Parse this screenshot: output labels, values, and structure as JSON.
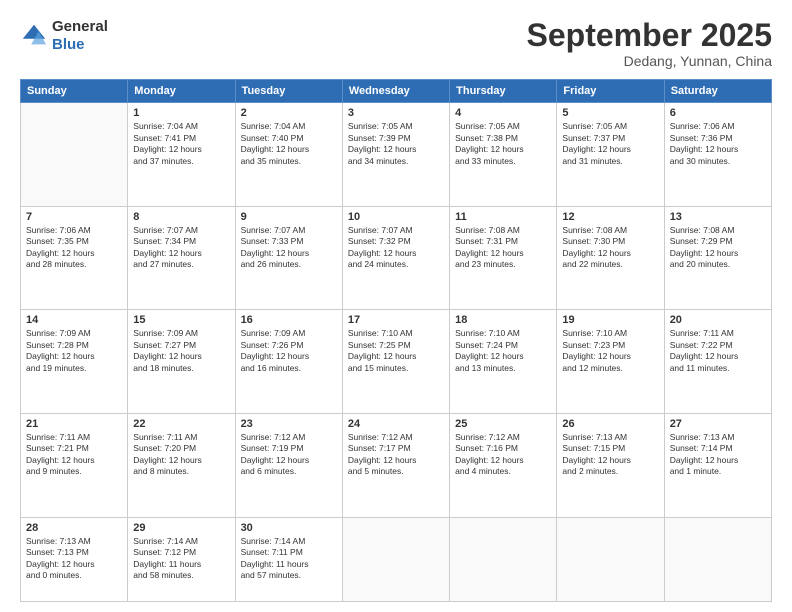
{
  "header": {
    "logo": {
      "general": "General",
      "blue": "Blue"
    },
    "month": "September 2025",
    "location": "Dedang, Yunnan, China"
  },
  "weekdays": [
    "Sunday",
    "Monday",
    "Tuesday",
    "Wednesday",
    "Thursday",
    "Friday",
    "Saturday"
  ],
  "weeks": [
    [
      {
        "num": "",
        "info": ""
      },
      {
        "num": "1",
        "info": "Sunrise: 7:04 AM\nSunset: 7:41 PM\nDaylight: 12 hours\nand 37 minutes."
      },
      {
        "num": "2",
        "info": "Sunrise: 7:04 AM\nSunset: 7:40 PM\nDaylight: 12 hours\nand 35 minutes."
      },
      {
        "num": "3",
        "info": "Sunrise: 7:05 AM\nSunset: 7:39 PM\nDaylight: 12 hours\nand 34 minutes."
      },
      {
        "num": "4",
        "info": "Sunrise: 7:05 AM\nSunset: 7:38 PM\nDaylight: 12 hours\nand 33 minutes."
      },
      {
        "num": "5",
        "info": "Sunrise: 7:05 AM\nSunset: 7:37 PM\nDaylight: 12 hours\nand 31 minutes."
      },
      {
        "num": "6",
        "info": "Sunrise: 7:06 AM\nSunset: 7:36 PM\nDaylight: 12 hours\nand 30 minutes."
      }
    ],
    [
      {
        "num": "7",
        "info": "Sunrise: 7:06 AM\nSunset: 7:35 PM\nDaylight: 12 hours\nand 28 minutes."
      },
      {
        "num": "8",
        "info": "Sunrise: 7:07 AM\nSunset: 7:34 PM\nDaylight: 12 hours\nand 27 minutes."
      },
      {
        "num": "9",
        "info": "Sunrise: 7:07 AM\nSunset: 7:33 PM\nDaylight: 12 hours\nand 26 minutes."
      },
      {
        "num": "10",
        "info": "Sunrise: 7:07 AM\nSunset: 7:32 PM\nDaylight: 12 hours\nand 24 minutes."
      },
      {
        "num": "11",
        "info": "Sunrise: 7:08 AM\nSunset: 7:31 PM\nDaylight: 12 hours\nand 23 minutes."
      },
      {
        "num": "12",
        "info": "Sunrise: 7:08 AM\nSunset: 7:30 PM\nDaylight: 12 hours\nand 22 minutes."
      },
      {
        "num": "13",
        "info": "Sunrise: 7:08 AM\nSunset: 7:29 PM\nDaylight: 12 hours\nand 20 minutes."
      }
    ],
    [
      {
        "num": "14",
        "info": "Sunrise: 7:09 AM\nSunset: 7:28 PM\nDaylight: 12 hours\nand 19 minutes."
      },
      {
        "num": "15",
        "info": "Sunrise: 7:09 AM\nSunset: 7:27 PM\nDaylight: 12 hours\nand 18 minutes."
      },
      {
        "num": "16",
        "info": "Sunrise: 7:09 AM\nSunset: 7:26 PM\nDaylight: 12 hours\nand 16 minutes."
      },
      {
        "num": "17",
        "info": "Sunrise: 7:10 AM\nSunset: 7:25 PM\nDaylight: 12 hours\nand 15 minutes."
      },
      {
        "num": "18",
        "info": "Sunrise: 7:10 AM\nSunset: 7:24 PM\nDaylight: 12 hours\nand 13 minutes."
      },
      {
        "num": "19",
        "info": "Sunrise: 7:10 AM\nSunset: 7:23 PM\nDaylight: 12 hours\nand 12 minutes."
      },
      {
        "num": "20",
        "info": "Sunrise: 7:11 AM\nSunset: 7:22 PM\nDaylight: 12 hours\nand 11 minutes."
      }
    ],
    [
      {
        "num": "21",
        "info": "Sunrise: 7:11 AM\nSunset: 7:21 PM\nDaylight: 12 hours\nand 9 minutes."
      },
      {
        "num": "22",
        "info": "Sunrise: 7:11 AM\nSunset: 7:20 PM\nDaylight: 12 hours\nand 8 minutes."
      },
      {
        "num": "23",
        "info": "Sunrise: 7:12 AM\nSunset: 7:19 PM\nDaylight: 12 hours\nand 6 minutes."
      },
      {
        "num": "24",
        "info": "Sunrise: 7:12 AM\nSunset: 7:17 PM\nDaylight: 12 hours\nand 5 minutes."
      },
      {
        "num": "25",
        "info": "Sunrise: 7:12 AM\nSunset: 7:16 PM\nDaylight: 12 hours\nand 4 minutes."
      },
      {
        "num": "26",
        "info": "Sunrise: 7:13 AM\nSunset: 7:15 PM\nDaylight: 12 hours\nand 2 minutes."
      },
      {
        "num": "27",
        "info": "Sunrise: 7:13 AM\nSunset: 7:14 PM\nDaylight: 12 hours\nand 1 minute."
      }
    ],
    [
      {
        "num": "28",
        "info": "Sunrise: 7:13 AM\nSunset: 7:13 PM\nDaylight: 12 hours\nand 0 minutes."
      },
      {
        "num": "29",
        "info": "Sunrise: 7:14 AM\nSunset: 7:12 PM\nDaylight: 11 hours\nand 58 minutes."
      },
      {
        "num": "30",
        "info": "Sunrise: 7:14 AM\nSunset: 7:11 PM\nDaylight: 11 hours\nand 57 minutes."
      },
      {
        "num": "",
        "info": ""
      },
      {
        "num": "",
        "info": ""
      },
      {
        "num": "",
        "info": ""
      },
      {
        "num": "",
        "info": ""
      }
    ]
  ]
}
